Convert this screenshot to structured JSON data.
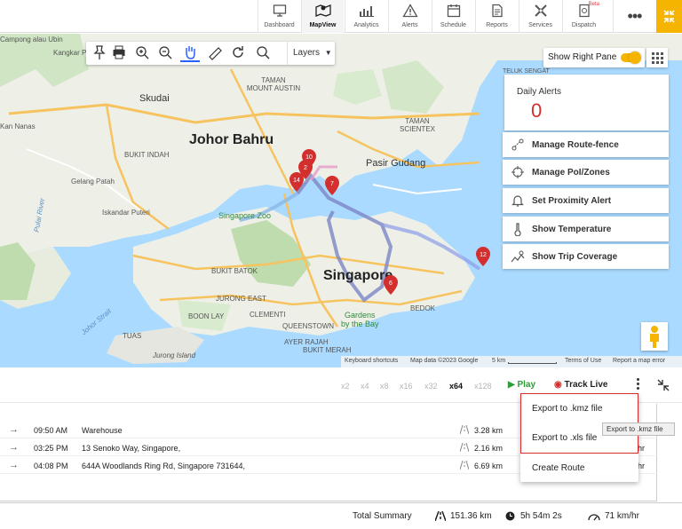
{
  "nav": {
    "items": [
      {
        "label": "Dashboard",
        "icon": "monitor-icon"
      },
      {
        "label": "MapView",
        "icon": "map-pin-icon",
        "active": true
      },
      {
        "label": "Analytics",
        "icon": "bar-chart-icon"
      },
      {
        "label": "Alerts",
        "icon": "warning-icon"
      },
      {
        "label": "Schedule",
        "icon": "calendar-icon"
      },
      {
        "label": "Reports",
        "icon": "document-icon"
      },
      {
        "label": "Services",
        "icon": "tools-icon"
      },
      {
        "label": "Dispatch",
        "icon": "dispatch-icon",
        "badge": "Beta"
      }
    ],
    "more": "•••"
  },
  "map": {
    "toolbar": {
      "layers_label": "Layers"
    },
    "right_pane_label": "Show Right Pane",
    "daily_alerts": {
      "title": "Daily Alerts",
      "value": "0"
    },
    "actions": [
      {
        "label": "Manage Route-fence",
        "icon": "route-fence-icon"
      },
      {
        "label": "Manage PoI/Zones",
        "icon": "crosshair-icon"
      },
      {
        "label": "Set Proximity Alert",
        "icon": "bell-icon"
      },
      {
        "label": "Show Temperature",
        "icon": "thermometer-icon"
      },
      {
        "label": "Show Trip Coverage",
        "icon": "trip-coverage-icon"
      }
    ],
    "labels": {
      "johor_bahru": "Johor Bahru",
      "singapore": "Singapore",
      "pasir_gudang": "Pasir Gudang",
      "skudai": "Skudai",
      "taman_mount_austin": "TAMAN\nMOUNT AUSTIN",
      "taman_scientex": "TAMAN\nSCIENTEX",
      "bukit_indah": "BUKIT INDAH",
      "gelang_patah": "Gelang Patah",
      "iskandar_puteri": "Iskandar Puteri",
      "kangkar_pulai": "Kangkar Pulai",
      "kan_nanas": "Kan Nanas",
      "singapore_zoo": "Singapore Zoo",
      "gardens_by_the_bay": "Gardens\nby the Bay",
      "bukit_batok": "BUKIT BATOK",
      "jurong_east": "JURONG EAST",
      "boon_lay": "BOON LAY",
      "clementi": "CLEMENTI",
      "queenstown": "QUEENSTOWN",
      "bedok": "BEDOK",
      "tuas": "TUAS",
      "bukit_merah": "BUKIT MERAH",
      "jurong_island": "Jurong Island",
      "ayer_rajah": "AYER RAJAH",
      "johor_strait": "Johor Strait",
      "pulai_river": "Pulai River",
      "teluk_sengat": "TELUK SENGAT",
      "kampong_pulau": "Campong\nalau Ubin"
    },
    "markers": [
      "10",
      "2",
      "14",
      "7",
      "6",
      "12"
    ],
    "attribution": {
      "shortcuts": "Keyboard shortcuts",
      "data": "Map data ©2023 Google",
      "scale": "5 km",
      "terms": "Terms of Use",
      "report": "Report a map error"
    }
  },
  "playback": {
    "speeds": [
      "x2",
      "x4",
      "x8",
      "x16",
      "x32",
      "x64",
      "x128"
    ],
    "selected_speed": "x64",
    "play_label": "Play",
    "track_live_label": "Track Live"
  },
  "trips": [
    {
      "time": "09:50 AM",
      "address": "Warehouse",
      "distance": "3.28 km",
      "speed": ""
    },
    {
      "time": "03:25 PM",
      "address": "13 Senoko Way, Singapore,",
      "distance": "2.16 km",
      "speed": "hr"
    },
    {
      "time": "04:08 PM",
      "address": "644A Woodlands Ring Rd, Singapore 731644,",
      "distance": "6.69 km",
      "speed": "hr"
    }
  ],
  "summary": {
    "label": "Total Summary",
    "distance": "151.36 km",
    "duration": "5h 54m 2s",
    "speed": "71 km/hr"
  },
  "export_menu": {
    "items": [
      "Export to .kmz file",
      "Export to .xls file",
      "Create Route"
    ],
    "tooltip": "Export to .kmz file"
  },
  "colors": {
    "accent": "#f5b400",
    "alert_red": "#d32f2f",
    "play_green": "#2e9e3b",
    "route_blue": "#7a86c4"
  }
}
